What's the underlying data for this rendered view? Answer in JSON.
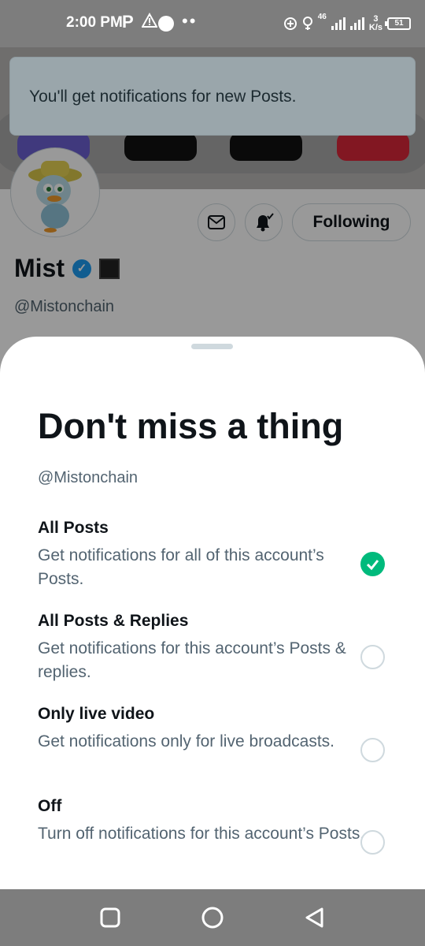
{
  "status_bar": {
    "time": "2:00 PM",
    "network": "46",
    "speed_value": "3",
    "speed_unit": "K/s",
    "battery": "51"
  },
  "profile": {
    "name": "Mist",
    "handle": "@Mistonchain",
    "follow_label": "Following"
  },
  "toast": {
    "message": "You'll get notifications for new Posts."
  },
  "sheet": {
    "title": "Don't miss a thing",
    "handle": "@Mistonchain",
    "options": [
      {
        "title": "All Posts",
        "description": "Get notifications for all of this account’s Posts.",
        "selected": true
      },
      {
        "title": "All Posts & Replies",
        "description": "Get notifications for this account’s Posts & replies.",
        "selected": false
      },
      {
        "title": "Only live video",
        "description": "Get notifications only for live broadcasts.",
        "selected": false
      },
      {
        "title": "Off",
        "description": "Turn off notifications for this account’s Posts.",
        "selected": false
      }
    ]
  },
  "colors": {
    "accent_green": "#00ba7c",
    "verified_blue": "#1d9bf0",
    "secondary_text": "#536471"
  },
  "icons": [
    "mail-icon",
    "bell-check-icon",
    "checkmark-icon",
    "recents-icon",
    "home-icon",
    "back-icon"
  ]
}
